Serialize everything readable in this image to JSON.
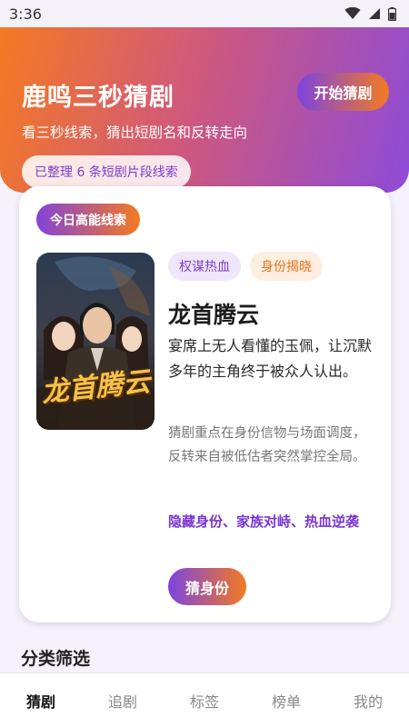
{
  "status_bar": {
    "time": "3:36"
  },
  "hero": {
    "title": "鹿鸣三秒猜剧",
    "start_button": "开始猜剧",
    "subtitle": "看三秒线索，猜出短剧名和反转走向",
    "count_label": "已整理 6 条短剧片段线索"
  },
  "card": {
    "badge": "今日高能线索",
    "poster_title": "龙首腾云",
    "tags": [
      "权谋热血",
      "身份揭晓"
    ],
    "title": "龙首腾云",
    "hook": "宴席上无人看懂的玉佩，让沉默多年的主角终于被众人认出。",
    "description": "猜剧重点在身份信物与场面调度，反转来自被低估者突然掌控全局。",
    "keywords": "隐藏身份、家族对峙、热血逆袭",
    "guess_button": "猜身份"
  },
  "section": {
    "title": "分类筛选"
  },
  "nav": {
    "items": [
      "猜剧",
      "追剧",
      "标签",
      "榜单",
      "我的"
    ],
    "active_index": 0
  },
  "colors": {
    "gradient_start": "#f47a22",
    "gradient_end": "#8e4bd8",
    "accent_purple": "#7c3fd0",
    "accent_orange": "#e8721c"
  }
}
